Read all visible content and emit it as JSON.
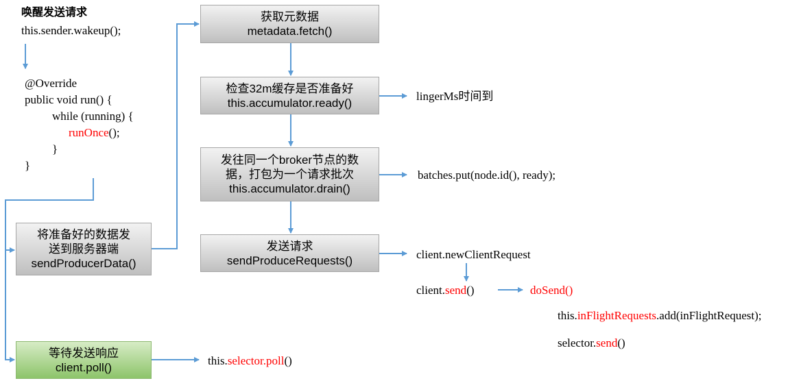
{
  "intro": {
    "title": "唤醒发送请求",
    "call": "this.sender.wakeup();"
  },
  "code": {
    "l1": "@Override",
    "l2": "public void run() {",
    "l3": "while (running) {",
    "l4": "runOnce",
    "l4b": "();",
    "l5": "}",
    "l6": "}"
  },
  "boxes": {
    "fetch": {
      "l1": "获取元数据",
      "l2": "metadata.fetch()"
    },
    "ready": {
      "l1": "检查32m缓存是否准备好",
      "l2": "this.accumulator.ready()"
    },
    "drain": {
      "l1": "发往同一个broker节点的数",
      "l2": "据，打包为一个请求批次",
      "l3": "this.accumulator.drain()"
    },
    "send": {
      "l1": "发送请求",
      "l2": "sendProduceRequests()"
    },
    "producer": {
      "l1": "将准备好的数据发",
      "l2": "送到服务器端",
      "l3": "sendProducerData()"
    },
    "poll": {
      "l1": "等待发送响应",
      "l2": "client.poll()"
    }
  },
  "notes": {
    "linger": "lingerMs时间到",
    "batches": "batches.put(node.id(), ready);",
    "newreq": "client.newClientRequest",
    "send_a": "client.",
    "send_b": "send",
    "send_c": "()",
    "dosend": "doSend()",
    "infl_a": "this.",
    "infl_b": "inFlightRequests",
    "infl_c": ".add(inFlightRequest);",
    "sel_a": "selector.",
    "sel_b": "send",
    "sel_c": "()",
    "poll_a": "this.",
    "poll_b": "selector.poll",
    "poll_c": "()"
  },
  "colors": {
    "arrow": "#5b9bd5",
    "highlight": "#ff0000"
  }
}
